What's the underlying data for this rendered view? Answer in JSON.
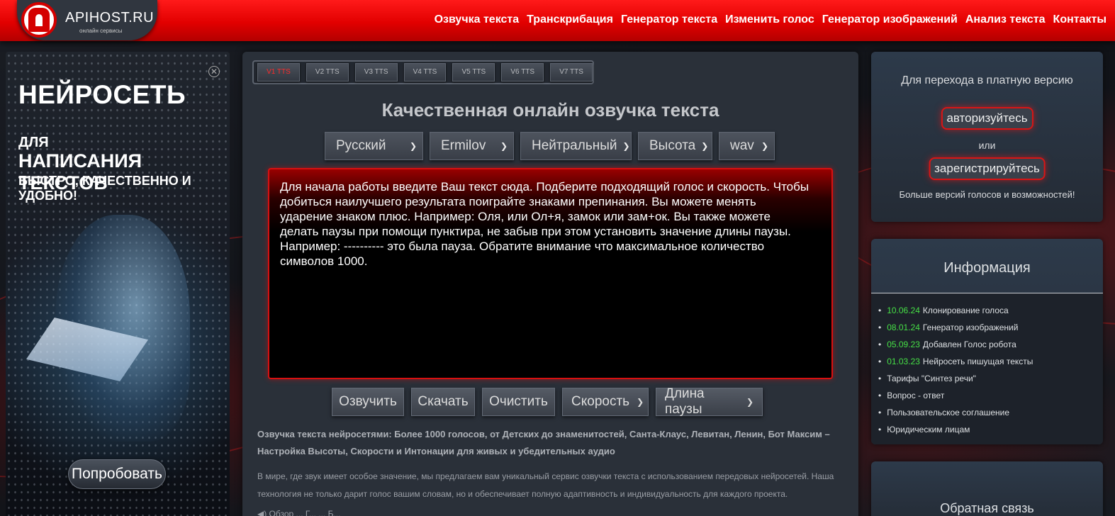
{
  "brand": {
    "name": "APIHOST.RU",
    "tagline": "онлайн сервисы"
  },
  "nav": [
    "Озвучка текста",
    "Транскрибация",
    "Генератор текста",
    "Изменить голос",
    "Генератор изображений",
    "Анализ текста",
    "Контакты"
  ],
  "ad": {
    "line1": "НЕЙРОСЕТЬ",
    "line2": "ДЛЯ",
    "line3": "НАПИСАНИЯ ТЕКСТОВ",
    "line4": "БЫСТРО, КАЧЕСТВЕННО И УДОБНО!",
    "button": "Попробовать",
    "close": "✕"
  },
  "tabs": [
    "V1 TTS",
    "V2 TTS",
    "V3 TTS",
    "V4 TTS",
    "V5 TTS",
    "V6 TTS",
    "V7 TTS"
  ],
  "active_tab": "V1 TTS",
  "main_title": "Качественная онлайн озвучка текста",
  "selects": {
    "language": "Русский",
    "voice": "Ermilov",
    "emotion": "Нейтральный",
    "pitch": "Высота",
    "format": "wav"
  },
  "textarea_text": "Для начала работы введите Ваш текст сюда. Подберите подходящий голос и скорость. Чтобы добиться наилучшего результата поиграйте знаками препинания. Вы можете менять ударение знаком плюс. Например: Оля, или Ол+я, замок или зам+ок. Вы также можете делать паузы при помощи пунктира, не забыв при этом установить значение длины паузы. Например: ---------- это была пауза. Обратите внимание что максимальное количество символов 1000.",
  "buttons": {
    "speak": "Озвучить",
    "download": "Скачать",
    "clear": "Очистить",
    "speed": "Скорость",
    "pause_length": "Длина паузы"
  },
  "description_bold": "Озвучка текста нейросетями: Более 1000 голосов, от Детских до знаменитостей, Санта-Клаус, Левитан, Ленин, Бот Максим – Настройка Высоты, Скорости и Интонации для живых и убедительных аудио",
  "description": "В мире, где звук имеет особое значение, мы предлагаем вам уникальный сервис озвучки текста с использованием передовых нейросетей. Наша технология не только дарит голос вашим словам, но и обеспечивает полную адаптивность и индивидуальность для каждого проекта.",
  "bottom_partial": "◀) Обзор ... Г... ... Б...",
  "paid": {
    "title": "Для перехода в платную версию",
    "login": "авторизуйтесь",
    "or": "или",
    "register": "зарегистрируйтесь",
    "more": "Больше версий голосов и возможностей!"
  },
  "info": {
    "title": "Информация",
    "items": [
      {
        "date": "10.06.24",
        "text": "Клонирование голоса"
      },
      {
        "date": "08.01.24",
        "text": "Генератор изображений"
      },
      {
        "date": "05.09.23",
        "text": "Добавлен Голос робота"
      },
      {
        "date": "01.03.23",
        "text": "Нейросеть пишущая тексты"
      },
      {
        "date": "",
        "text": "Тарифы \"Синтез речи\""
      },
      {
        "date": "",
        "text": "Вопрос - ответ"
      },
      {
        "date": "",
        "text": "Пользовательское соглашение"
      },
      {
        "date": "",
        "text": "Юридическим лицам"
      }
    ]
  },
  "feedback": {
    "title": "Обратная связь"
  },
  "colors": {
    "header_red": "#e20000",
    "accent_red": "#d81515",
    "date_green": "#46e046",
    "panel": "#2a3039"
  }
}
